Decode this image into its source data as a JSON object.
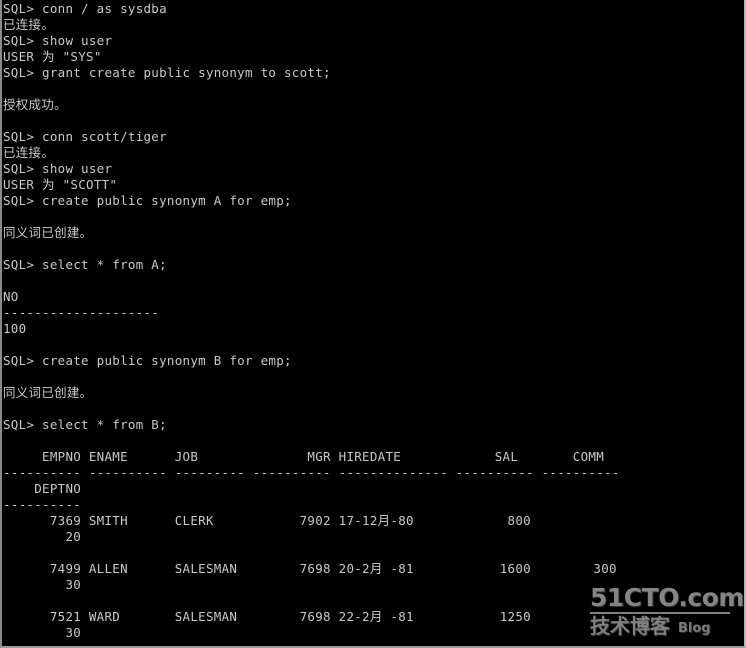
{
  "terminal": {
    "app": "SQL*Plus",
    "prompt": "SQL>",
    "foreground_color": "#c9c9c9",
    "background_color": "#000000",
    "lines": [
      "SQL> conn / as sysdba",
      "已连接。",
      "SQL> show user",
      "USER 为 \"SYS\"",
      "SQL> grant create public synonym to scott;",
      "",
      "授权成功。",
      "",
      "SQL> conn scott/tiger",
      "已连接。",
      "SQL> show user",
      "USER 为 \"SCOTT\"",
      "SQL> create public synonym A for emp;",
      "",
      "同义词已创建。",
      "",
      "SQL> select * from A;",
      "",
      "NO",
      "--------------------",
      "100",
      "",
      "SQL> create public synonym B for emp;",
      "",
      "同义词已创建。",
      "",
      "SQL> select * from B;",
      "",
      "     EMPNO ENAME      JOB              MGR HIREDATE            SAL       COMM",
      "---------- ---------- --------- ---------- -------------- ---------- ----------",
      "    DEPTNO",
      "----------",
      "      7369 SMITH      CLERK           7902 17-12月-80            800",
      "        20",
      "",
      "      7499 ALLEN      SALESMAN        7698 20-2月 -81           1600        300",
      "        30",
      "",
      "      7521 WARD       SALESMAN        7698 22-2月 -81           1250",
      "        30"
    ]
  },
  "commands": [
    {
      "prompt": "SQL>",
      "text": "conn / as sysdba",
      "result": "已连接。"
    },
    {
      "prompt": "SQL>",
      "text": "show user",
      "result": "USER 为 \"SYS\""
    },
    {
      "prompt": "SQL>",
      "text": "grant create public synonym to scott;",
      "result": "授权成功。"
    },
    {
      "prompt": "SQL>",
      "text": "conn scott/tiger",
      "result": "已连接。"
    },
    {
      "prompt": "SQL>",
      "text": "show user",
      "result": "USER 为 \"SCOTT\""
    },
    {
      "prompt": "SQL>",
      "text": "create public synonym A for emp;",
      "result": "同义词已创建。"
    },
    {
      "prompt": "SQL>",
      "text": "select * from A;",
      "result": ""
    },
    {
      "prompt": "SQL>",
      "text": "create public synonym B for emp;",
      "result": "同义词已创建。"
    },
    {
      "prompt": "SQL>",
      "text": "select * from B;",
      "result": ""
    }
  ],
  "result_tables": [
    {
      "name": "query-a-result",
      "columns": [
        "NO"
      ],
      "separator": [
        "--------------------"
      ],
      "rows": [
        [
          "100"
        ]
      ]
    },
    {
      "name": "query-b-result",
      "columns": [
        "EMPNO",
        "ENAME",
        "JOB",
        "MGR",
        "HIREDATE",
        "SAL",
        "COMM",
        "DEPTNO"
      ],
      "rows": [
        {
          "EMPNO": "7369",
          "ENAME": "SMITH",
          "JOB": "CLERK",
          "MGR": "7902",
          "HIREDATE": "17-12月-80",
          "SAL": "800",
          "COMM": "",
          "DEPTNO": "20"
        },
        {
          "EMPNO": "7499",
          "ENAME": "ALLEN",
          "JOB": "SALESMAN",
          "MGR": "7698",
          "HIREDATE": "20-2月 -81",
          "SAL": "1600",
          "COMM": "300",
          "DEPTNO": "30"
        },
        {
          "EMPNO": "7521",
          "ENAME": "WARD",
          "JOB": "SALESMAN",
          "MGR": "7698",
          "HIREDATE": "22-2月 -81",
          "SAL": "1250",
          "COMM": "",
          "DEPTNO": "30"
        }
      ]
    }
  ],
  "watermark": {
    "top": "51CTO.com",
    "cn": "技术博客",
    "blog": "Blog"
  }
}
